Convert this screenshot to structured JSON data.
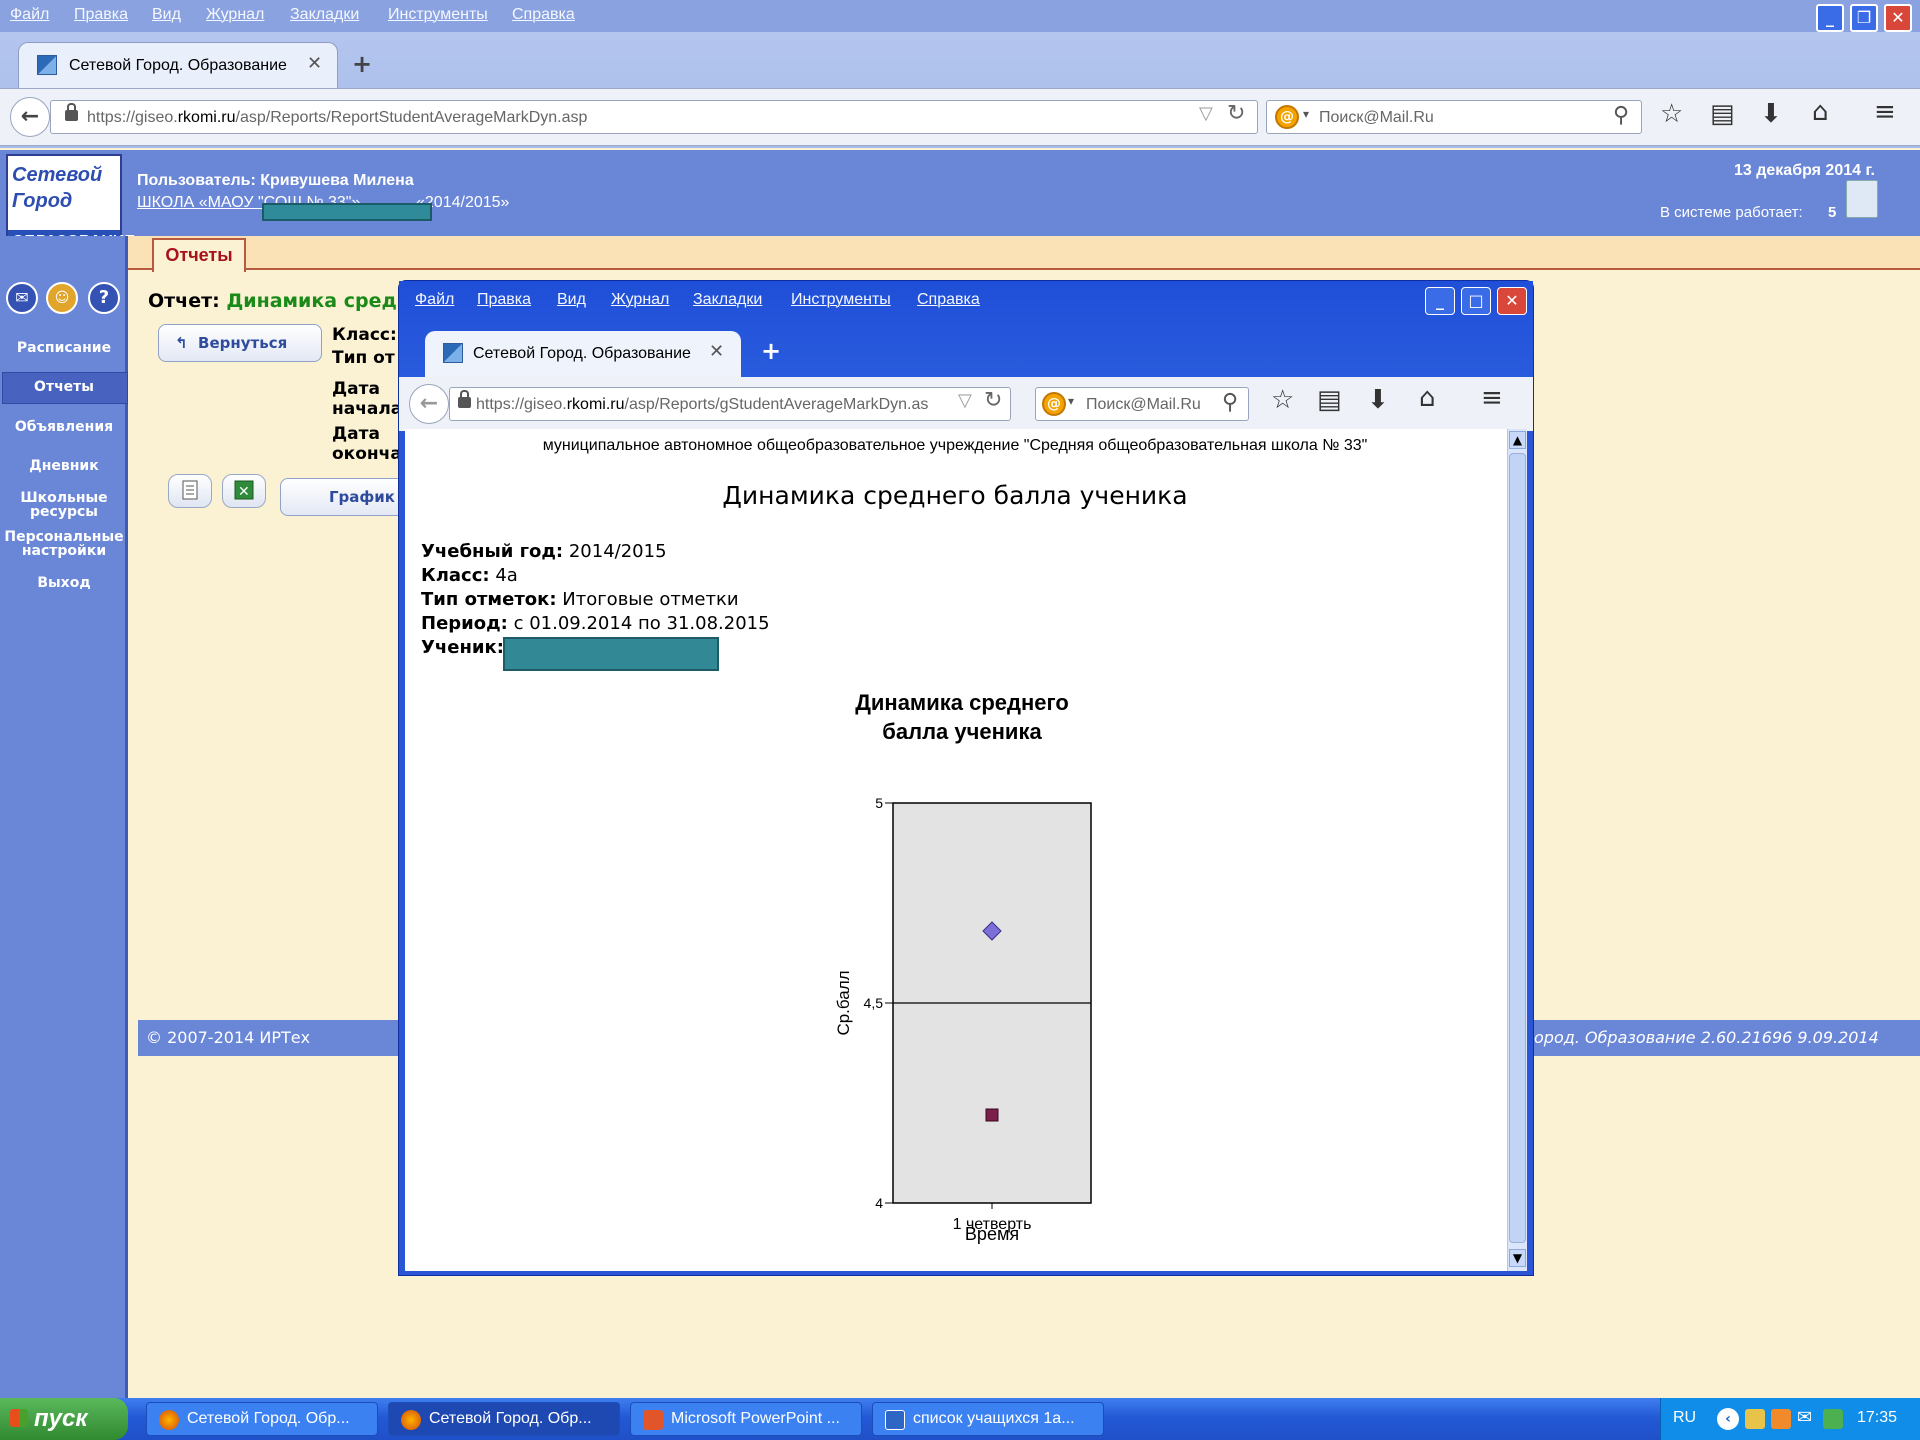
{
  "outer_browser": {
    "menu": [
      "Файл",
      "Правка",
      "Вид",
      "Журнал",
      "Закладки",
      "Инструменты",
      "Справка"
    ],
    "tab_title": "Сетевой Город. Образование",
    "url_prefix": "https://giseo.",
    "url_domain": "rkomi.ru",
    "url_path": "/asp/Reports/ReportStudentAverageMarkDyn.asp",
    "search_placeholder": "Поиск@Mail.Ru"
  },
  "app": {
    "logo": {
      "line1": "Сетевой",
      "line2": "Город",
      "line3": "ОБРАЗОВАНИЕ"
    },
    "user_label": "Пользователь: Кривушева Милена",
    "school": "ШКОЛА «МАОУ \"СОШ № 33\"»",
    "year": "«2014/2015»",
    "date": "13 декабря 2014 г.",
    "online_label": "В системе работает:",
    "online_count": "5",
    "tab_reports": "Отчеты",
    "sidebar": [
      "Расписание",
      "Отчеты",
      "Объявления",
      "Дневник",
      "Школьные ресурсы",
      "Персональные настройки",
      "Выход"
    ],
    "report_label": "Отчет:",
    "report_name": "Динамика сред",
    "back_button": "Вернуться",
    "fields": {
      "class": "Класс:",
      "type": "Тип от",
      "start1": "Дата",
      "start2": "начала",
      "end1": "Дата",
      "end2": "оконча"
    },
    "graph_button": "График",
    "copyright": "© 2007-2014 ИРТех",
    "version": "ород. Образование 2.60.21696   9.09.2014"
  },
  "popup": {
    "menu": [
      "Файл",
      "Правка",
      "Вид",
      "Журнал",
      "Закладки",
      "Инструменты",
      "Справка"
    ],
    "tab_title": "Сетевой Город. Образование",
    "url_prefix": "https://giseo.",
    "url_domain": "rkomi.ru",
    "url_path": "/asp/Reports/gStudentAverageMarkDyn.as",
    "search_placeholder": "Поиск@Mail.Ru",
    "org": "муниципальное автономное общеобразовательное учреждение \"Средняя общеобразовательная школа № 33\"",
    "report_title": "Динамика среднего балла ученика",
    "year_label": "Учебный год:",
    "year_value": "2014/2015",
    "class_label": "Класс:",
    "class_value": "4а",
    "type_label": "Тип отметок:",
    "type_value": "Итоговые отметки",
    "period_label": "Период:",
    "period_value": "с 01.09.2014 по 31.08.2015",
    "student_label": "Ученик:"
  },
  "chart_data": {
    "type": "scatter",
    "title": "Динамика среднего балла ученика",
    "xlabel": "Время",
    "ylabel": "Ср.балл",
    "categories": [
      "1 четверть"
    ],
    "ylim": [
      4,
      5
    ],
    "yticks": [
      "4",
      "4,5",
      "5"
    ],
    "grid": true,
    "series": [
      {
        "values": [
          4.68
        ],
        "color": "#7b6fd8",
        "marker": "diamond"
      },
      {
        "values": [
          4.22
        ],
        "color": "#7a1e4a",
        "marker": "square"
      }
    ]
  },
  "taskbar": {
    "start": "пуск",
    "tasks": [
      "Сетевой Город. Обр...",
      "Сетевой Город. Обр...",
      "Microsoft PowerPoint ...",
      "список учащихся 1а..."
    ],
    "lang": "RU",
    "time": "17:35"
  }
}
